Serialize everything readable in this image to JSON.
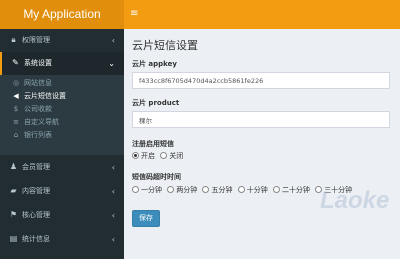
{
  "app": {
    "title": "My Application",
    "menu_toggle_icon": "hamburger-icon"
  },
  "sidebar": {
    "items": [
      {
        "label": "权限管理",
        "icon": "lock-icon"
      },
      {
        "label": "系统设置",
        "icon": "wrench-icon",
        "active": true
      },
      {
        "label": "会员管理",
        "icon": "users-icon"
      },
      {
        "label": "内容管理",
        "icon": "folder-icon"
      },
      {
        "label": "核心管理",
        "icon": "flag-icon"
      },
      {
        "label": "统计信息",
        "icon": "file-icon"
      }
    ],
    "submenu": [
      {
        "label": "网站信息",
        "icon": "circle-icon"
      },
      {
        "label": "云片短信设置",
        "icon": "bullhorn-icon",
        "active": true
      },
      {
        "label": "公司收款",
        "icon": "dollar-icon"
      },
      {
        "label": "自定义导航",
        "icon": "list-icon"
      },
      {
        "label": "银行列表",
        "icon": "bank-icon"
      }
    ]
  },
  "page": {
    "title": "云片短信设置",
    "appkey": {
      "label": "云片 appkey",
      "value": "f433cc8f6705d470d4a2ccb5861fe226"
    },
    "product": {
      "label": "云片 product",
      "value": "稞尔"
    },
    "register_sms": {
      "label": "注册启用短信",
      "options": [
        "开启",
        "关闭"
      ],
      "selected": "开启"
    },
    "timeout": {
      "label": "短信码超时时间",
      "options": [
        "一分钟",
        "两分钟",
        "五分钟",
        "十分钟",
        "二十分钟",
        "三十分钟"
      ]
    },
    "save_label": "保存"
  },
  "watermark": "Laoke",
  "colors": {
    "header": "#f39c12",
    "logo_bg": "#e08e0b",
    "sidebar": "#222d32",
    "primary": "#3c8dbc"
  }
}
